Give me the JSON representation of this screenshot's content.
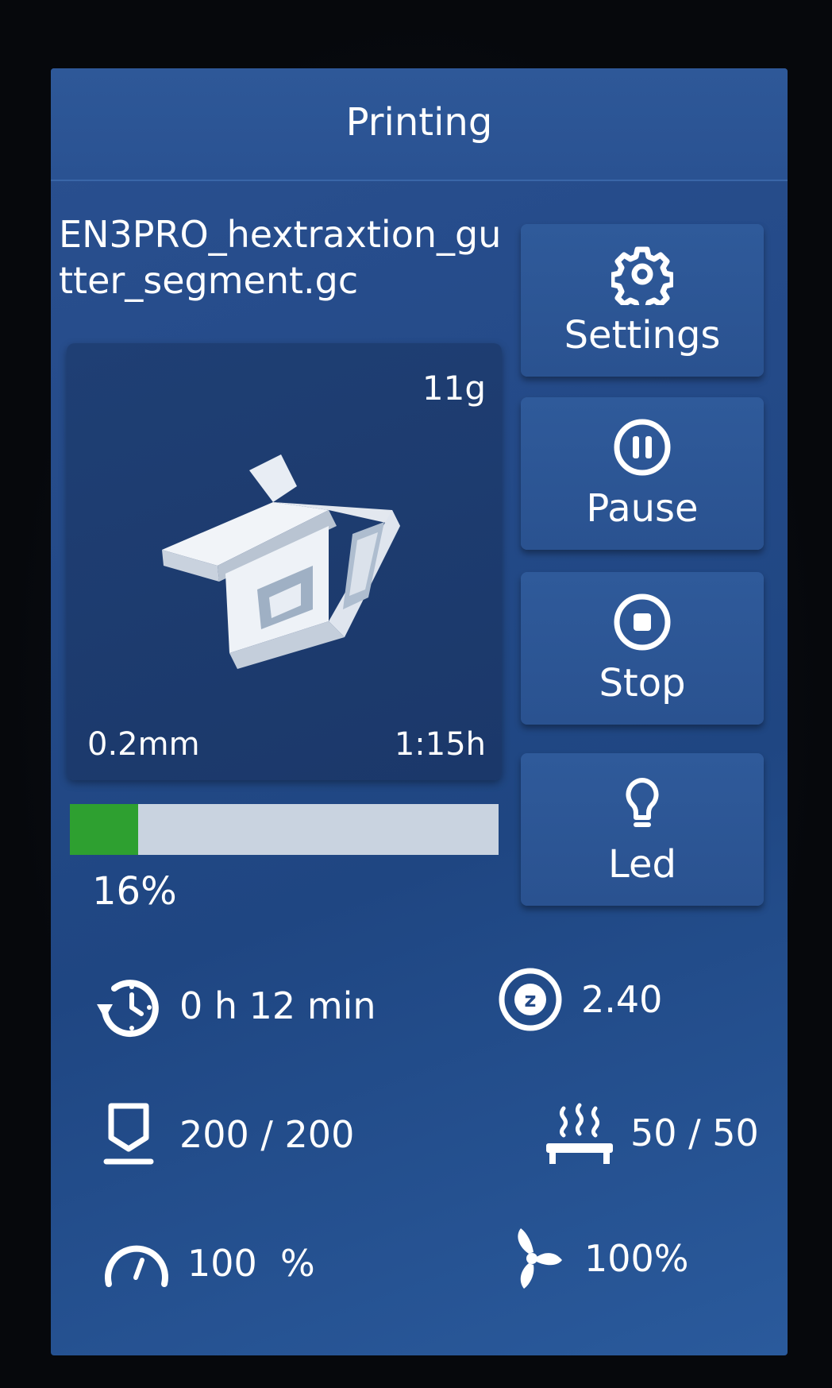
{
  "header": {
    "title": "Printing"
  },
  "file": {
    "name": "EN3PRO_hextraxtion_gutter_segment.gc"
  },
  "preview": {
    "weight": "11g",
    "layer_height": "0.2mm",
    "estimated_time": "1:15h"
  },
  "progress": {
    "percent_label": "16%",
    "fraction": 0.16,
    "fill_color": "#2ea030"
  },
  "buttons": {
    "settings": {
      "label": "Settings",
      "icon": "gear-icon"
    },
    "pause": {
      "label": "Pause",
      "icon": "pause-icon"
    },
    "stop": {
      "label": "Stop",
      "icon": "stop-icon"
    },
    "led": {
      "label": "Led",
      "icon": "lightbulb-icon"
    }
  },
  "stats": {
    "elapsed": {
      "value": "0 h 12 min",
      "icon": "timer-icon"
    },
    "z_height": {
      "value": "2.40",
      "icon": "z-axis-icon"
    },
    "nozzle_temp": {
      "value": "200 / 200",
      "icon": "nozzle-icon"
    },
    "bed_temp": {
      "value": "50 / 50",
      "icon": "heated-bed-icon"
    },
    "speed": {
      "value": "100  %",
      "icon": "speedometer-icon"
    },
    "fan": {
      "value": "100%",
      "icon": "fan-icon"
    }
  },
  "colors": {
    "background": "#244a88",
    "progress_track": "#c9d3e0",
    "progress_fill": "#2ea030"
  }
}
